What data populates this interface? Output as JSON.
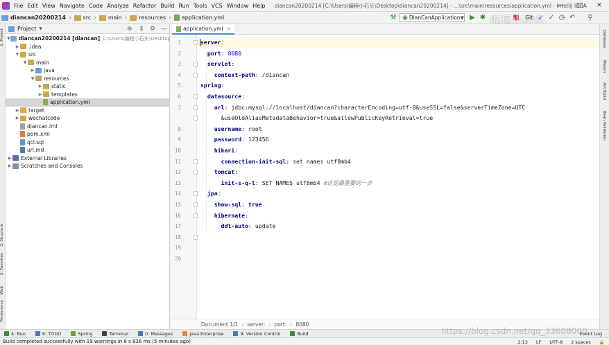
{
  "menubar": {
    "items": [
      "File",
      "Edit",
      "View",
      "Navigate",
      "Code",
      "Analyze",
      "Refactor",
      "Build",
      "Run",
      "Tools",
      "VCS",
      "Window",
      "Help"
    ],
    "title": "diancan20200214 [C:\\Users\\编程小石头\\Desktop\\diancan20200214] - ...\\src\\main\\resources\\application.yml - IntelliJ IDEA"
  },
  "navbar": {
    "crumbs": [
      "diancan20200214",
      "src",
      "main",
      "resources",
      "application.yml"
    ],
    "run_config": "DianCanApplication",
    "git_label": "Git:",
    "watermark": "编程小石头"
  },
  "left_tool_tabs": [
    "1: Project",
    "2: Structure",
    "2: Favorites",
    "Web",
    "Persistence"
  ],
  "project_panel": {
    "title": "Project",
    "tree": [
      {
        "label": "diancan20200214 [diancan]",
        "path": "C:\\Users\\编程小石头\\Desktop\\dianc",
        "icon": "folder-blue",
        "depth": 0,
        "arrow": "down",
        "bold": true
      },
      {
        "label": ".idea",
        "icon": "folder",
        "depth": 1,
        "arrow": "right"
      },
      {
        "label": "src",
        "icon": "folder",
        "depth": 1,
        "arrow": "down"
      },
      {
        "label": "main",
        "icon": "folder",
        "depth": 2,
        "arrow": "down"
      },
      {
        "label": "java",
        "icon": "folder-src",
        "depth": 3,
        "arrow": "right"
      },
      {
        "label": "resources",
        "icon": "folder-res",
        "depth": 3,
        "arrow": "down"
      },
      {
        "label": "static",
        "icon": "folder",
        "depth": 4,
        "arrow": "right"
      },
      {
        "label": "templates",
        "icon": "folder",
        "depth": 4,
        "arrow": "right"
      },
      {
        "label": "application.yml",
        "icon": "yml",
        "depth": 4,
        "arrow": "",
        "selected": true
      },
      {
        "label": "target",
        "icon": "folder-target",
        "depth": 1,
        "arrow": "right"
      },
      {
        "label": "wechatcode",
        "icon": "folder",
        "depth": 1,
        "arrow": "right"
      },
      {
        "label": "diancan.iml",
        "icon": "iml",
        "depth": 1,
        "arrow": ""
      },
      {
        "label": "pom.xml",
        "icon": "xml",
        "depth": 1,
        "arrow": ""
      },
      {
        "label": "qcl.sql",
        "icon": "sql",
        "depth": 1,
        "arrow": ""
      },
      {
        "label": "url.md",
        "icon": "md",
        "depth": 1,
        "arrow": ""
      },
      {
        "label": "External Libraries",
        "icon": "lib",
        "depth": 0,
        "arrow": "right"
      },
      {
        "label": "Scratches and Consoles",
        "icon": "scratch",
        "depth": 0,
        "arrow": "right"
      }
    ]
  },
  "editor": {
    "tab_label": "application.yml",
    "line_numbers": [
      "1",
      "2",
      "3",
      "4",
      "5",
      "6",
      "7",
      "",
      "8",
      "9",
      "10",
      "11",
      "12",
      "13",
      "14",
      "15",
      "16",
      "17",
      "18",
      "19",
      "20"
    ],
    "lines": [
      {
        "indent": "",
        "key": "server",
        "value": "",
        "vclass": ""
      },
      {
        "indent": "  ",
        "key": "port",
        "value": "8080",
        "vclass": "v-num"
      },
      {
        "indent": "  ",
        "key": "servlet",
        "value": "",
        "vclass": ""
      },
      {
        "indent": "    ",
        "key": "context-path",
        "value": "/diancan",
        "vclass": ""
      },
      {
        "indent": "",
        "key": "spring",
        "value": "",
        "vclass": ""
      },
      {
        "indent": "  ",
        "key": "datasource",
        "value": "",
        "vclass": ""
      },
      {
        "indent": "    ",
        "key": "url",
        "value": "jdbc:mysql://localhost/diancan?characterEncoding=utf-8&useSSL=false&serverTimeZone=UTC",
        "vclass": ""
      },
      {
        "indent": "      ",
        "key": "",
        "value": "&useOldAliasMetadataBehavior=true&allowPublicKeyRetrieval=true",
        "vclass": ""
      },
      {
        "indent": "    ",
        "key": "username",
        "value": "root",
        "vclass": ""
      },
      {
        "indent": "    ",
        "key": "password",
        "value": "123456",
        "vclass": ""
      },
      {
        "indent": "    ",
        "key": "hikari",
        "value": "",
        "vclass": ""
      },
      {
        "indent": "      ",
        "key": "connection-init-sql",
        "value": "set names utf8mb4",
        "vclass": ""
      },
      {
        "indent": "    ",
        "key": "tomcat",
        "value": "",
        "vclass": ""
      },
      {
        "indent": "      ",
        "key": "init-s-q-l",
        "value": "SET NAMES utf8mb4",
        "vclass": "",
        "comment": "#这是最重要的一步"
      },
      {
        "indent": "  ",
        "key": "jpa",
        "value": "",
        "vclass": ""
      },
      {
        "indent": "    ",
        "key": "show-sql",
        "value": "true",
        "vclass": "v-kw"
      },
      {
        "indent": "    ",
        "key": "hibernate",
        "value": "",
        "vclass": ""
      },
      {
        "indent": "      ",
        "key": "ddl-auto",
        "value": "update",
        "vclass": ""
      },
      {
        "indent": "",
        "key": "",
        "value": "",
        "vclass": ""
      },
      {
        "indent": "",
        "key": "",
        "value": "",
        "vclass": ""
      }
    ],
    "breadcrumb": [
      "Document 1/1",
      "server:",
      "port:",
      "8080"
    ]
  },
  "right_tool_tabs": [
    "Database",
    "Maven",
    "Ant Build",
    "Bean Validation"
  ],
  "bottom_tools": [
    "4: Run",
    "6: TODO",
    "Spring",
    "Terminal",
    "0: Messages",
    "Java Enterprise",
    "9: Version Control",
    "Build"
  ],
  "event_log": "Event Log",
  "status": {
    "message": "Build completed successfully with 19 warnings in 8 s 836 ms (5 minutes ago)",
    "position": "2:13",
    "line_sep": "LF",
    "encoding": "UTF-8",
    "indent": "2 spaces"
  },
  "watermark_bottom": "https://blog.csdn.net/qq_33608000",
  "colors": {
    "accent": "#4a88c7",
    "key": "#000080",
    "number": "#0000ff",
    "comment": "#8c8c8c"
  }
}
